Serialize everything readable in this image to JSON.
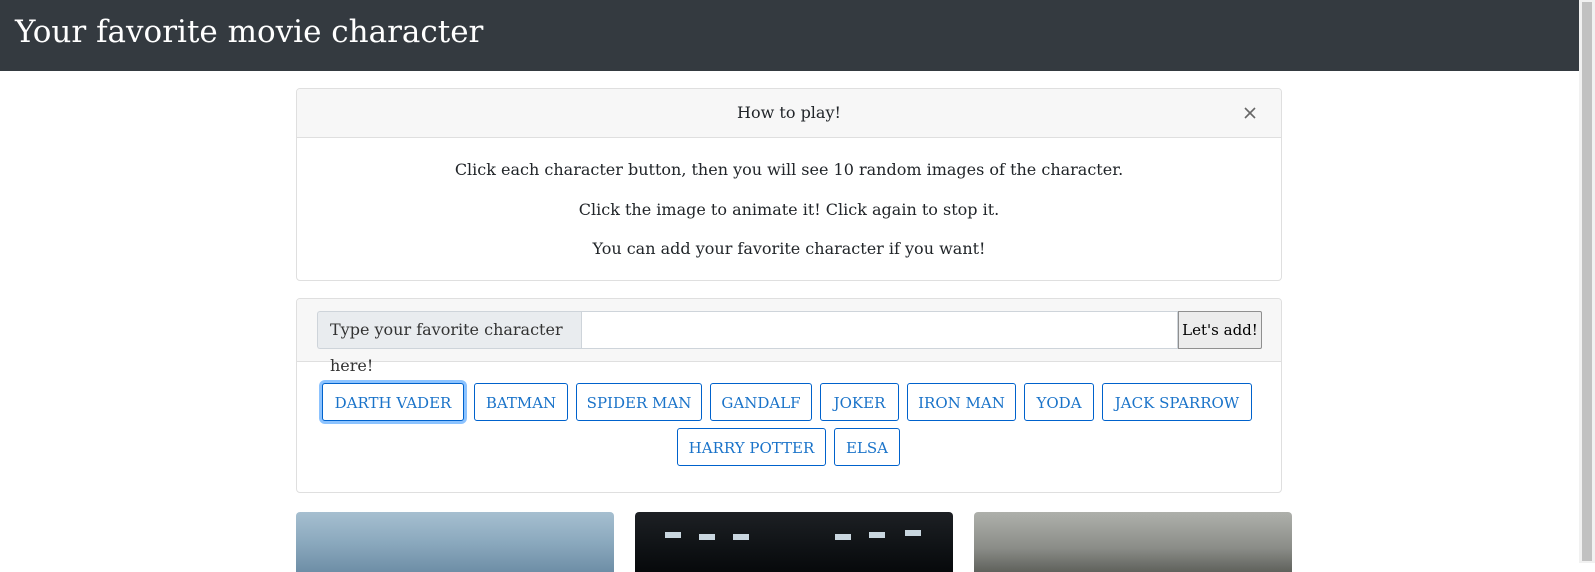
{
  "navbar": {
    "title": "Your favorite movie character"
  },
  "howto": {
    "title": "How to play!",
    "lines": [
      "Click each character button, then you will see 10 random images of the character.",
      "Click the image to animate it! Click again to stop it.",
      "You can add your favorite character if you want!"
    ]
  },
  "add_form": {
    "prompt": "Type your favorite character here!",
    "input_value": "",
    "button_label": "Let's add!"
  },
  "characters": [
    "DARTH VADER",
    "BATMAN",
    "SPIDER MAN",
    "GANDALF",
    "JOKER",
    "IRON MAN",
    "YODA",
    "JACK SPARROW",
    "HARRY POTTER",
    "ELSA"
  ],
  "theme": {
    "navbar_bg": "#343a40",
    "accent": "#007bff"
  },
  "icons": {
    "close": "close-icon"
  }
}
